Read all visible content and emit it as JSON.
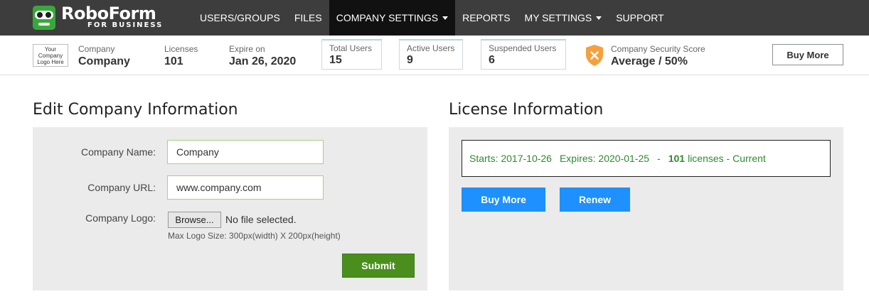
{
  "brand": {
    "name": "RoboForm",
    "tagline": "FOR BUSINESS"
  },
  "nav": {
    "items": [
      {
        "label": "USERS/GROUPS",
        "active": false,
        "dropdown": false
      },
      {
        "label": "FILES",
        "active": false,
        "dropdown": false
      },
      {
        "label": "COMPANY SETTINGS",
        "active": true,
        "dropdown": true
      },
      {
        "label": "REPORTS",
        "active": false,
        "dropdown": false
      },
      {
        "label": "MY SETTINGS",
        "active": false,
        "dropdown": true
      },
      {
        "label": "SUPPORT",
        "active": false,
        "dropdown": false
      }
    ]
  },
  "infobar": {
    "company_logo_text": "Your Company Logo Here",
    "company": {
      "label": "Company",
      "value": "Company"
    },
    "licenses": {
      "label": "Licenses",
      "value": "101"
    },
    "expire": {
      "label": "Expire on",
      "value": "Jan 26, 2020"
    },
    "total_users": {
      "label": "Total Users",
      "value": "15"
    },
    "active_users": {
      "label": "Active Users",
      "value": "9"
    },
    "suspended_users": {
      "label": "Suspended Users",
      "value": "6"
    },
    "security": {
      "label": "Company Security Score",
      "value": "Average / 50%"
    },
    "buy_more_label": "Buy More"
  },
  "edit_company": {
    "title": "Edit Company Information",
    "name_label": "Company Name:",
    "name_value": "Company",
    "url_label": "Company URL:",
    "url_value": "www.company.com",
    "logo_label": "Company Logo:",
    "browse_label": "Browse...",
    "no_file_text": "No file selected.",
    "hint": "Max Logo Size: 300px(width) X 200px(height)",
    "submit_label": "Submit"
  },
  "license": {
    "title": "License Information",
    "starts": "Starts: 2017-10-26",
    "expires": "Expires: 2020-01-25",
    "separator": "-",
    "count": "101",
    "suffix": "licenses - Current",
    "buy_more_label": "Buy More",
    "renew_label": "Renew"
  },
  "colors": {
    "nav_bg": "#3d3d3d",
    "nav_active": "#111111",
    "brand_green": "#37a93a",
    "submit_green": "#4a8f1e",
    "primary_blue": "#1e90ff",
    "license_text_green": "#2e8b2e",
    "shield_orange": "#f5a03c"
  }
}
